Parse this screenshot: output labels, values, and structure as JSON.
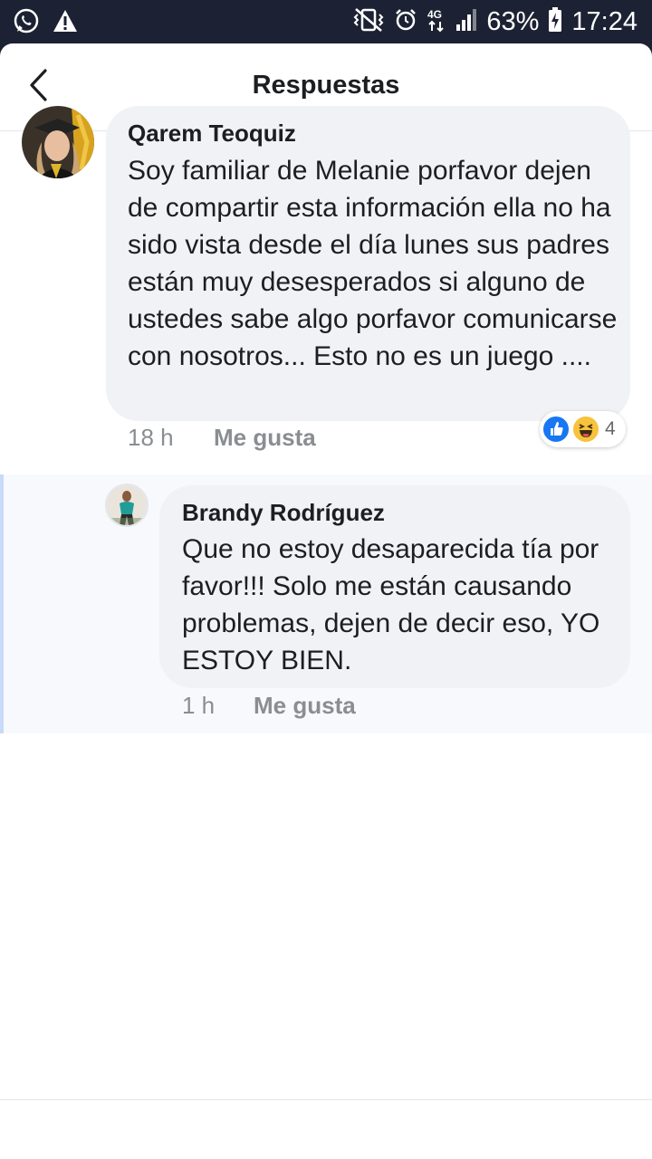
{
  "status_bar": {
    "battery": "63%",
    "time": "17:24",
    "network": "4G",
    "icons": [
      "whatsapp-icon",
      "warning-icon",
      "vibrate-icon",
      "alarm-icon",
      "network-4g-icon",
      "signal-icon",
      "battery-icon"
    ]
  },
  "header": {
    "title": "Respuestas",
    "back_icon": "chevron-left-icon"
  },
  "comment": {
    "author": "Qarem Teoquiz",
    "text": "Soy familiar de Melanie porfavor dejen de compartir esta información ella no ha sido vista desde el día lunes sus padres están muy desesperados si alguno de ustedes sabe algo porfavor comunicarse con nosotros... Esto no es un juego ....",
    "time": "18 h",
    "like_label": "Me gusta",
    "reactions": {
      "types": [
        "like-reaction-icon",
        "haha-reaction-icon"
      ],
      "count": "4"
    }
  },
  "reply": {
    "author": "Brandy Rodríguez",
    "text": "Que no estoy desaparecida tía por favor!!! Solo me están causando problemas, dejen de decir eso, YO ESTOY BIEN.",
    "time": "1 h",
    "like_label": "Me gusta"
  },
  "colors": {
    "status_bar_bg": "#1c2233",
    "bubble_bg": "#f0f2f5",
    "reply_section_bg": "#f7f9fd",
    "thread_line": "#c8daf8",
    "like_blue": "#1877f2",
    "haha_yellow": "#f7c23c",
    "meta_gray": "#8a8d91"
  }
}
